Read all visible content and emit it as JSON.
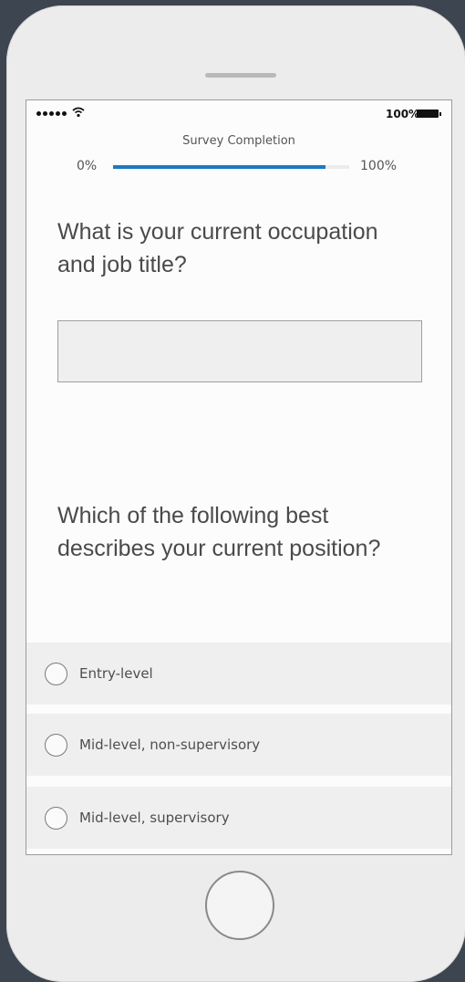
{
  "status_bar": {
    "battery_text": "100%",
    "icons": [
      "signal-dots-icon",
      "wifi-icon",
      "battery-icon"
    ]
  },
  "progress": {
    "title": "Survey Completion",
    "start_label": "0%",
    "end_label": "100%",
    "fraction": 0.9,
    "accent_color": "#1e78c2"
  },
  "question1": {
    "text": "What is your current occupation and job title?",
    "input_value": ""
  },
  "question2": {
    "text": "Which of the following best describes your current position?",
    "options": [
      {
        "label": "Entry-level"
      },
      {
        "label": "Mid-level, non-supervisory"
      },
      {
        "label": "Mid-level, supervisory"
      }
    ]
  }
}
